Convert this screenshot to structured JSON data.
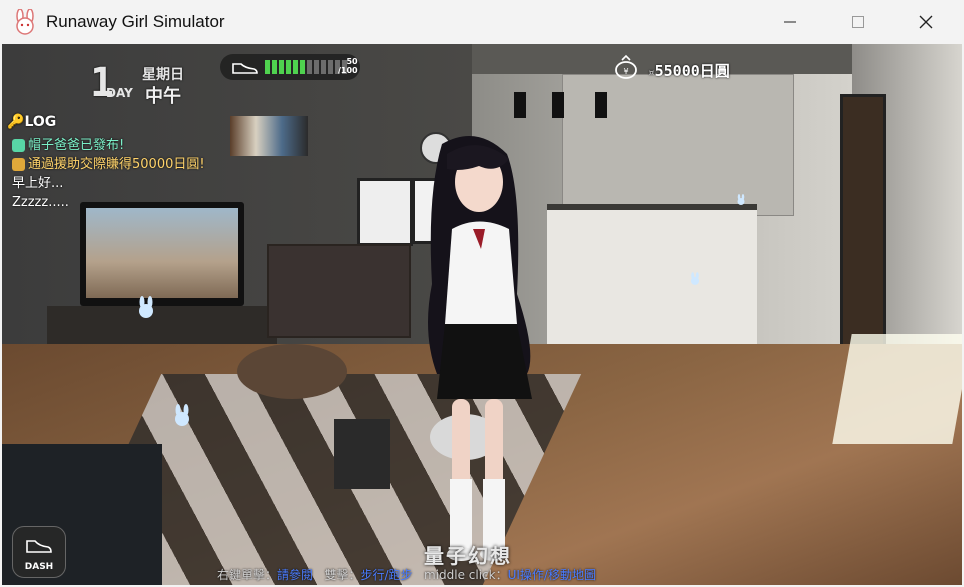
{
  "window": {
    "title": "Runaway Girl Simulator"
  },
  "hud": {
    "day": "1",
    "day_label": "DAY",
    "weekday": "星期日",
    "time_of_day": "中午",
    "stamina": {
      "current": "50",
      "max": "/100",
      "fraction": 0.5
    },
    "money": "55000日圓",
    "log_title": "LOG",
    "log": [
      {
        "text": "帽子爸爸已發布!",
        "style": "green"
      },
      {
        "text": "通過援助交際賺得50000日圓!",
        "style": "yellow"
      },
      {
        "text": "早上好...",
        "style": "white"
      },
      {
        "text": "Zzzzz.....",
        "style": "white"
      }
    ],
    "dash_label": "DASH",
    "watermark": "量子幻想",
    "hint": {
      "right_label": "右鍵單擊：",
      "right_action": "請參閱",
      "double_label": "雙擊：",
      "double_action": "步行/跑步",
      "middle_label": "middle click：",
      "middle_action": "UI操作/移動地圖"
    }
  },
  "icons": {
    "app": "bunny-icon",
    "stamina": "shoe-icon",
    "money": "coin-icon",
    "log": "key-icon",
    "dash": "shoe-icon"
  },
  "colors": {
    "stamina_on": "#4fd24f",
    "log_green": "#7bf0c8",
    "log_yellow": "#ffd36a",
    "hint_highlight": "#4a7cff"
  }
}
